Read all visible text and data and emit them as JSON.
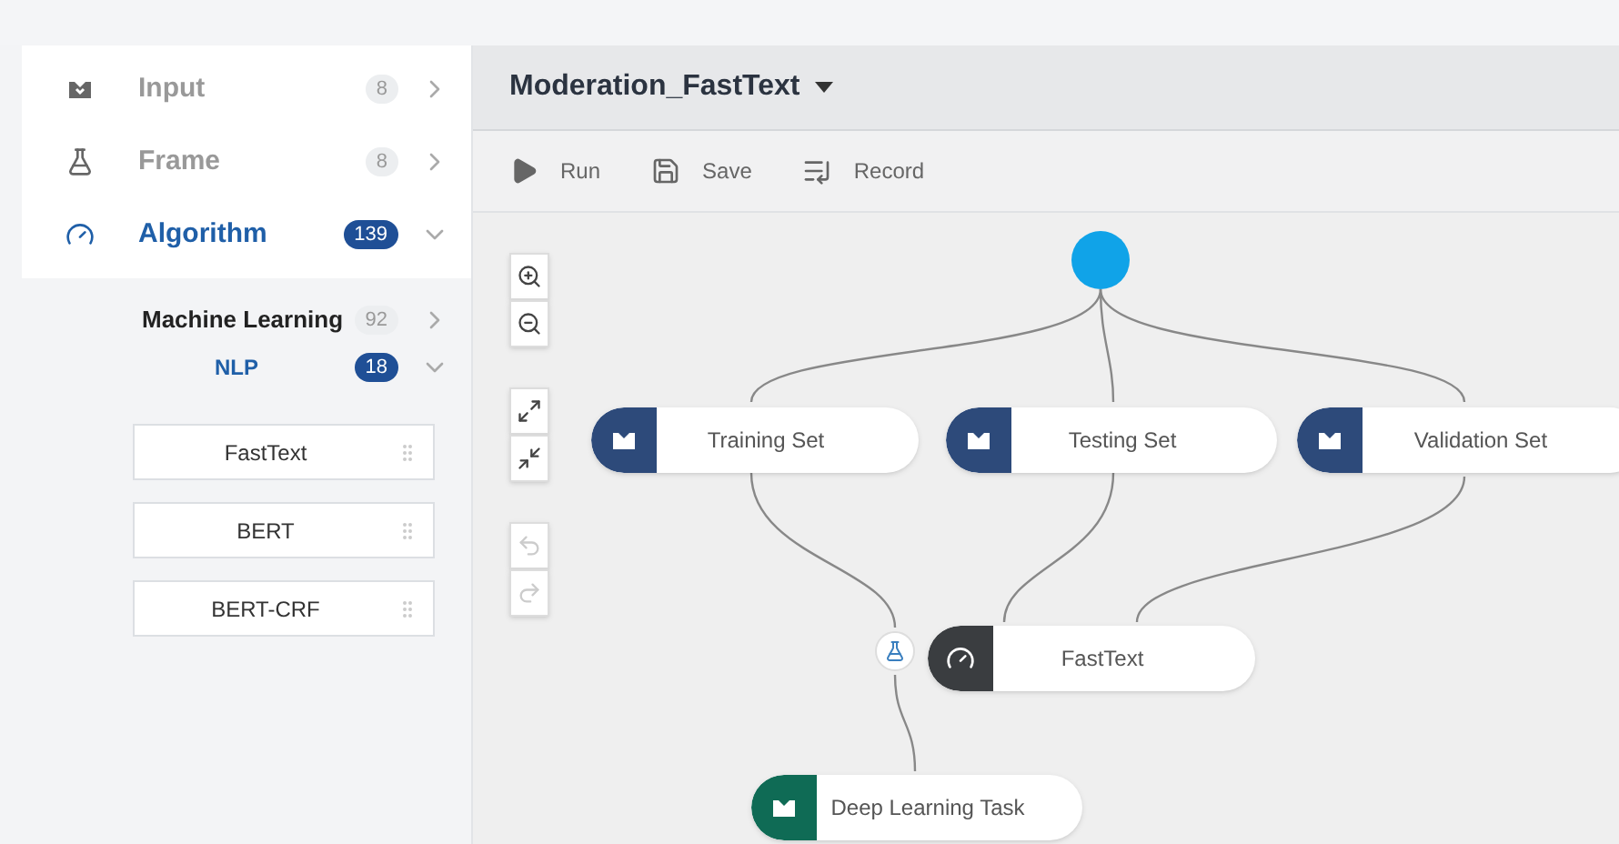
{
  "sidebar": {
    "categories": [
      {
        "label": "Input",
        "count": "8",
        "selected": false,
        "expanded": false
      },
      {
        "label": "Frame",
        "count": "8",
        "selected": false,
        "expanded": false
      },
      {
        "label": "Algorithm",
        "count": "139",
        "selected": true,
        "expanded": true
      }
    ],
    "subcategories": [
      {
        "label": "Machine Learning",
        "count": "92",
        "selected": false,
        "expanded": false,
        "children": [
          {
            "label": "NLP",
            "count": "18",
            "selected": true,
            "expanded": true
          }
        ]
      }
    ],
    "models": [
      "FastText",
      "BERT",
      "BERT-CRF"
    ]
  },
  "workflow": {
    "title": "Moderation_FastText",
    "toolbar": [
      "Run",
      "Save",
      "Record"
    ],
    "canvas_tools": [
      {
        "disabled": false
      },
      {
        "disabled": false
      },
      {
        "disabled": false
      },
      {
        "disabled": false
      },
      {
        "disabled": true
      },
      {
        "disabled": true
      }
    ],
    "nodes": [
      {
        "label": "Training Set",
        "kind": "input"
      },
      {
        "label": "Testing Set",
        "kind": "input"
      },
      {
        "label": "Validation Set",
        "kind": "input"
      },
      {
        "label": "FastText",
        "kind": "algorithm"
      },
      {
        "label": "Deep Learning Task",
        "kind": "output"
      }
    ]
  }
}
